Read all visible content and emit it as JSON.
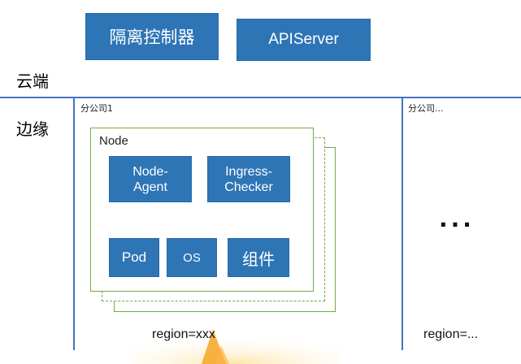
{
  "cloud": {
    "label": "云端",
    "isolation_controller": "隔离控制器",
    "apiserver": "APIServer"
  },
  "edge": {
    "label": "边缘",
    "branch1": {
      "title": "分公司1",
      "node_title": "Node",
      "node_agent": "Node-\nAgent",
      "ingress_checker": "Ingress-\nChecker",
      "pod": "Pod",
      "os": "OS",
      "component": "组件",
      "region": "region=xxx"
    },
    "branch_more": {
      "title": "分公司...",
      "ellipsis": "...",
      "region": "region=..."
    }
  },
  "colors": {
    "box_fill": "#2e75b6",
    "divider": "#4472c4",
    "node_border": "#70ad47",
    "watermark": "#f5a623"
  }
}
